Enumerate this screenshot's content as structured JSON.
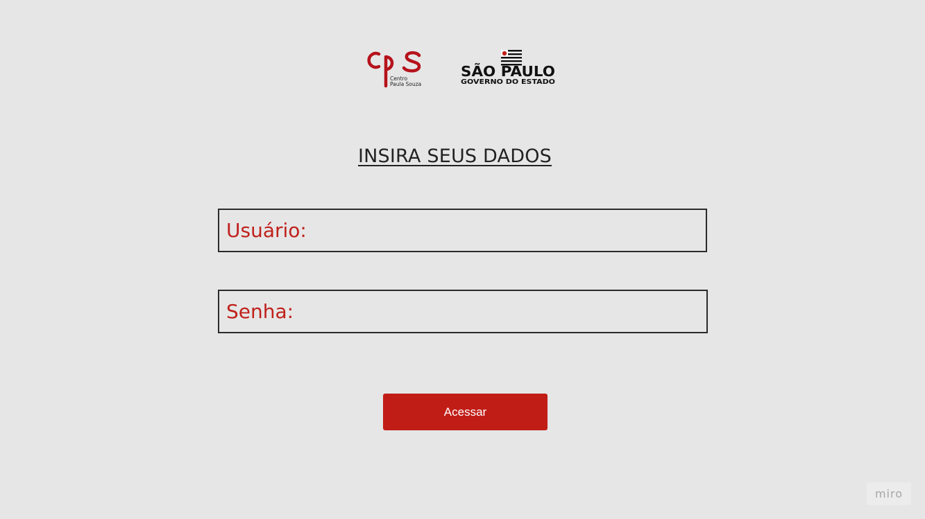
{
  "logos": {
    "cps_text": "Centro\nPaula Souza",
    "sp_title": "SÃO PAULO",
    "sp_subtitle": "GOVERNO DO ESTADO"
  },
  "form": {
    "title": "INSIRA SEUS DADOS",
    "user_placeholder": "Usuário:",
    "user_value": "",
    "password_placeholder": "Senha:",
    "password_value": "",
    "submit_label": "Acessar"
  },
  "watermark": {
    "label": "miro"
  },
  "colors": {
    "background": "#e6e6e6",
    "accent": "#c11d17",
    "field_text": "#c0201b",
    "border": "#2a2a2a"
  }
}
